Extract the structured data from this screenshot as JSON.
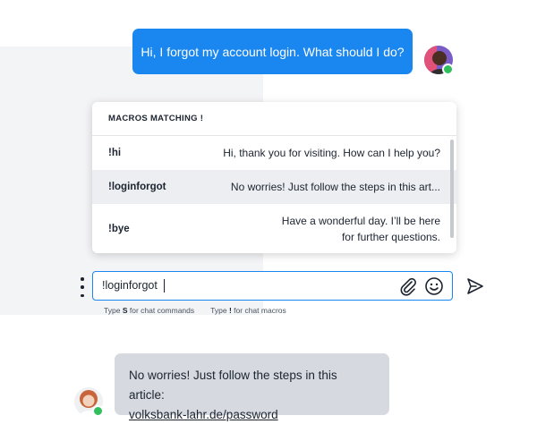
{
  "colors": {
    "accent": "#1a86f0",
    "outgoing_bubble": "#1a86f0",
    "incoming_bubble": "#d6dae0",
    "online_status": "#2fbf5b",
    "selected_row": "#eceef1"
  },
  "messages": {
    "outgoing": {
      "text": "Hi, I forgot my account login. What should I do?",
      "avatar_icon": "user-avatar-icon",
      "status": "online"
    },
    "incoming": {
      "text": "No worries! Just follow the steps in this article:",
      "link": "volksbank-lahr.de/password",
      "avatar_icon": "agent-avatar-icon",
      "status": "online"
    }
  },
  "macros": {
    "header": "MACROS MATCHING !",
    "items": [
      {
        "key": "!hi",
        "text": "Hi, thank you for visiting. How can I help you?",
        "selected": false
      },
      {
        "key": "!loginforgot",
        "text": "No worries! Just follow the steps in this art...",
        "selected": true
      },
      {
        "key": "!bye",
        "text_line1": "Have a wonderful day. I’ll be here",
        "text_line2": "for further questions.",
        "selected": false
      }
    ]
  },
  "composer": {
    "value": "!loginforgot",
    "menu_icon": "more-vertical-icon",
    "attach_icon": "paperclip-icon",
    "emoji_icon": "smiley-icon",
    "send_icon": "send-icon"
  },
  "hints": {
    "commands_prefix": "Type",
    "commands_key": "S",
    "commands_suffix": "for chat commands",
    "macros_prefix": "Type",
    "macros_key": "!",
    "macros_suffix": "for chat macros"
  }
}
